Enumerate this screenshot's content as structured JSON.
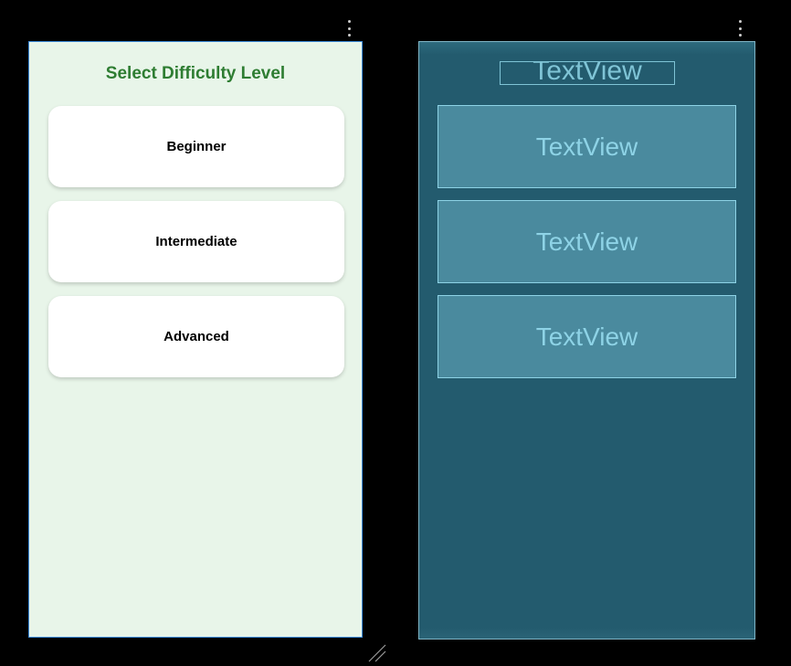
{
  "design": {
    "title": "Select Difficulty Level",
    "levels": [
      "Beginner",
      "Intermediate",
      "Advanced"
    ],
    "colors": {
      "background": "#e8f5e9",
      "title": "#2e7d32",
      "card": "#ffffff",
      "frame_border": "#3d8bd9"
    }
  },
  "blueprint": {
    "title_placeholder": "TextView",
    "boxes": [
      "TextView",
      "TextView",
      "TextView"
    ],
    "colors": {
      "background": "#235b6e",
      "box": "#4a8a9e",
      "outline": "#8ed3e6"
    }
  },
  "icons": {
    "menu": "vertical-ellipsis-icon",
    "resize": "resize-handle-icon"
  }
}
